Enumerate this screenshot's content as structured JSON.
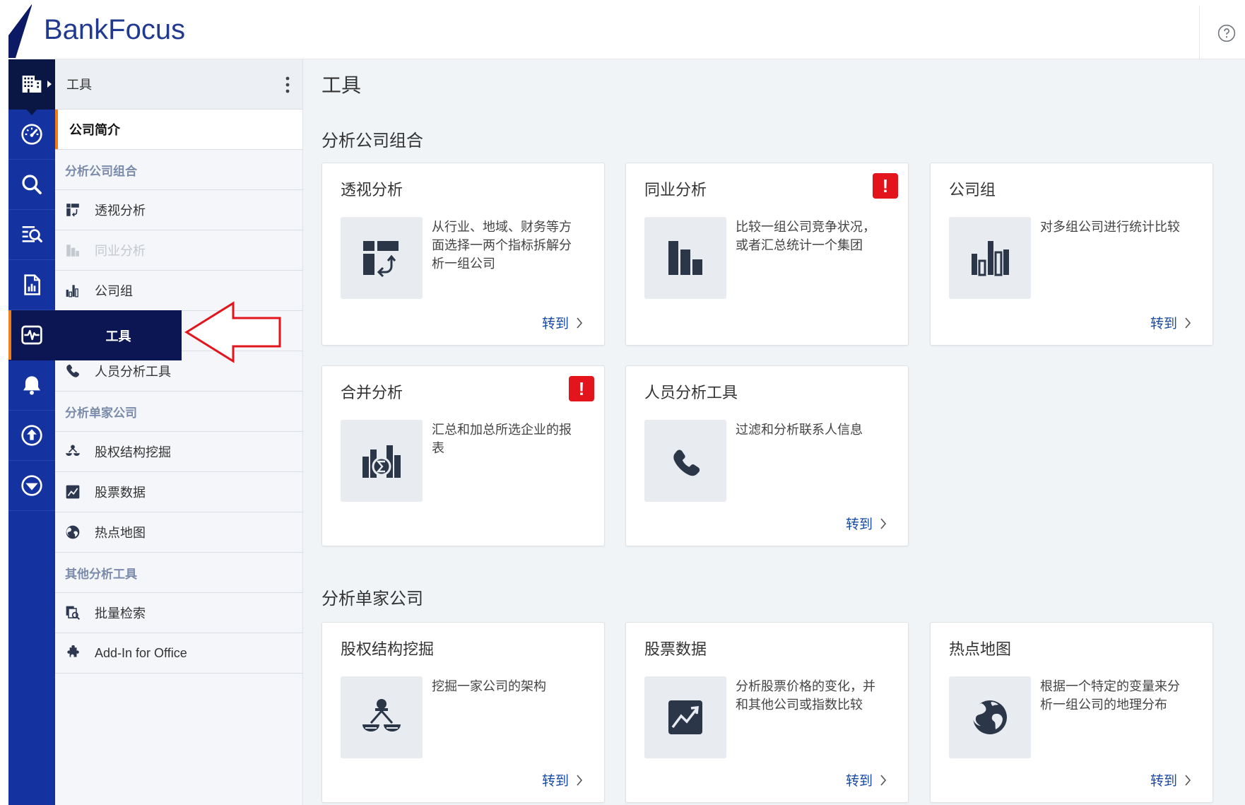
{
  "header": {
    "logo_text": "BankFocus",
    "help_icon": "help-circle-icon"
  },
  "rail": {
    "items": [
      {
        "icon": "building-icon",
        "state": "current"
      },
      {
        "icon": "dashboard-gauge-icon"
      },
      {
        "icon": "search-icon"
      },
      {
        "icon": "list-search-icon"
      },
      {
        "icon": "report-chart-icon"
      },
      {
        "icon": "pulse-monitor-icon",
        "state": "hover"
      },
      {
        "icon": "bell-icon"
      },
      {
        "icon": "upload-circle-icon"
      },
      {
        "icon": "download-circle-icon"
      }
    ],
    "flyout": {
      "label": "工具"
    }
  },
  "sidebar": {
    "title": "工具",
    "menu_icon": "more-vertical-icon",
    "items": [
      {
        "type": "item",
        "label": "公司简介",
        "state": "active"
      },
      {
        "type": "group",
        "label": "分析公司组合"
      },
      {
        "type": "item",
        "label": "透视分析",
        "icon": "pivot-icon"
      },
      {
        "type": "item",
        "label": "同业分析",
        "icon": "peer-bars-icon",
        "state": "disabled"
      },
      {
        "type": "item",
        "label": "公司组",
        "icon": "company-group-icon"
      },
      {
        "type": "item",
        "label": "人员分析工具",
        "icon": "phone-icon"
      },
      {
        "type": "group",
        "label": "分析单家公司"
      },
      {
        "type": "item",
        "label": "股权结构挖掘",
        "icon": "ownership-tree-icon"
      },
      {
        "type": "item",
        "label": "股票数据",
        "icon": "stock-chart-icon"
      },
      {
        "type": "item",
        "label": "热点地图",
        "icon": "globe-icon"
      },
      {
        "type": "group",
        "label": "其他分析工具"
      },
      {
        "type": "item",
        "label": "批量检索",
        "icon": "batch-search-icon"
      },
      {
        "type": "item",
        "label": "Add-In for Office",
        "icon": "puzzle-icon"
      }
    ]
  },
  "main": {
    "title": "工具",
    "sections": [
      {
        "title": "分析公司组合",
        "cards": [
          {
            "title": "透视分析",
            "icon": "pivot-icon",
            "description": "从行业、地域、财务等方面选择一两个指标拆解分析一组公司",
            "link": "转到"
          },
          {
            "title": "同业分析",
            "icon": "peer-bars-icon",
            "description": "比较一组公司竞争状况，或者汇总统计一个集团",
            "alert": "!"
          },
          {
            "title": "公司组",
            "icon": "company-group-icon",
            "description": "对多组公司进行统计比较",
            "link": "转到"
          },
          {
            "title": "合并分析",
            "icon": "consolidate-icon",
            "description": "汇总和加总所选企业的报表",
            "alert": "!"
          },
          {
            "title": "人员分析工具",
            "icon": "phone-icon",
            "description": "过滤和分析联系人信息",
            "link": "转到"
          }
        ]
      },
      {
        "title": "分析单家公司",
        "cards": [
          {
            "title": "股权结构挖掘",
            "icon": "ownership-tree-icon",
            "description": "挖掘一家公司的架构",
            "link": "转到"
          },
          {
            "title": "股票数据",
            "icon": "stock-chart-icon",
            "description": "分析股票价格的变化，并和其他公司或指数比较",
            "link": "转到"
          },
          {
            "title": "热点地图",
            "icon": "globe-icon",
            "description": "根据一个特定的变量来分析一组公司的地理分布",
            "link": "转到"
          }
        ]
      }
    ]
  },
  "annotation": {
    "shape": "left-arrow",
    "color": "#e3141b"
  },
  "colors": {
    "brand": "#213a8f",
    "rail_bg": "#1433a0",
    "rail_selected": "#0c1652",
    "accent": "#f07d1a",
    "link": "#1a4aa3",
    "alert": "#e3141b",
    "icon": "#2b3648"
  }
}
